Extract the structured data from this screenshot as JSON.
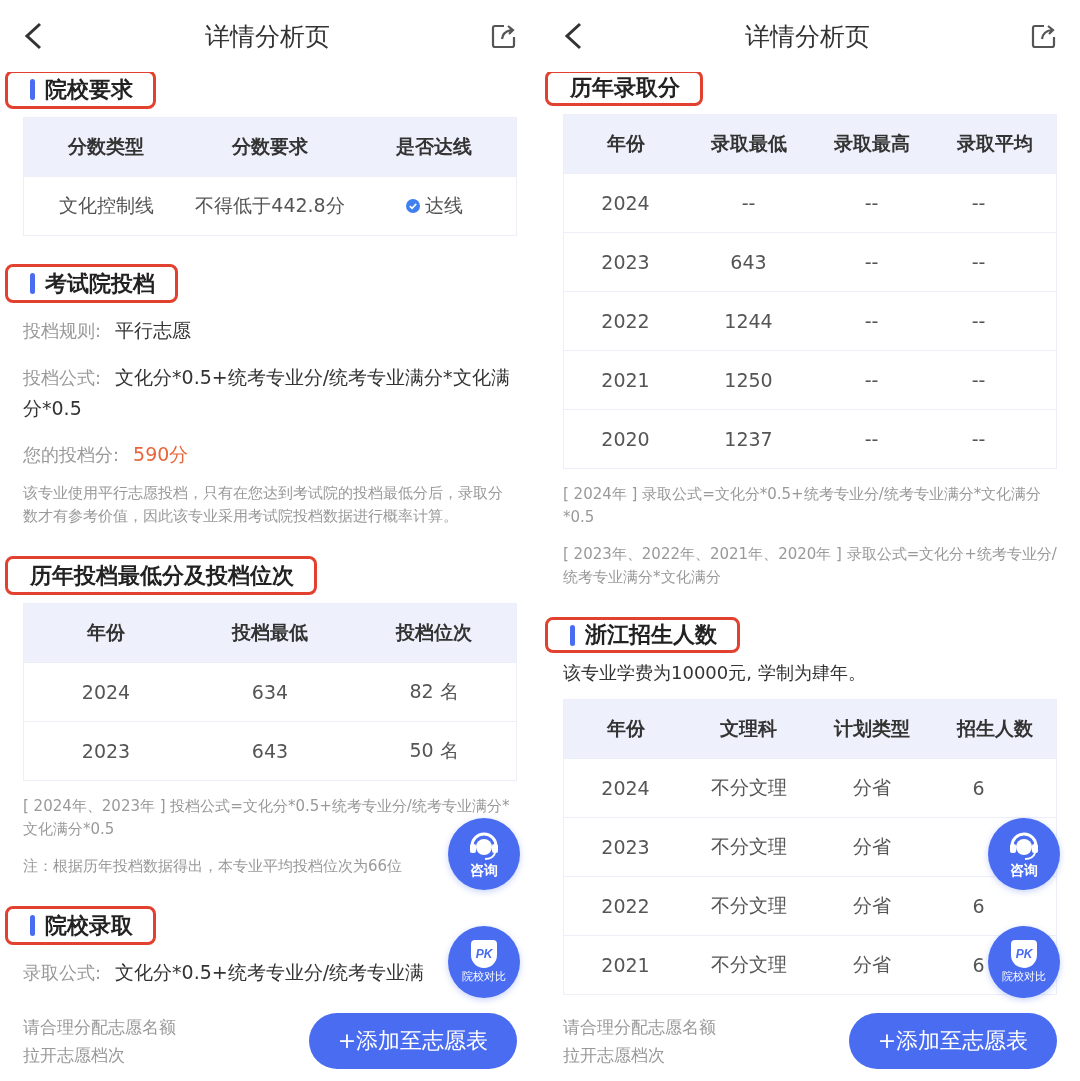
{
  "screens": [
    {
      "title": "详情分析页",
      "blocks": [
        {
          "kind": "heading",
          "text": "院校要求",
          "accent": true,
          "highlighted": true
        },
        {
          "kind": "table",
          "columns": [
            "分数类型",
            "分数要求",
            "是否达线"
          ],
          "rows": [
            {
              "cells": [
                "文化控制线",
                "不得低于442.8分",
                "达线"
              ],
              "reached": true
            }
          ]
        },
        {
          "kind": "heading",
          "text": "考试院投档",
          "accent": true,
          "highlighted": true
        },
        {
          "kind": "field",
          "label": "投档规则:",
          "value": "平行志愿",
          "emphasis": false
        },
        {
          "kind": "field",
          "label": "投档公式:",
          "value": "文化分*0.5+统考专业分/统考专业满分*文化满分*0.5",
          "emphasis": false
        },
        {
          "kind": "field",
          "label": "您的投档分:",
          "value": "590分",
          "emphasis": true
        },
        {
          "kind": "note",
          "text": "该专业使用平行志愿投档，只有在您达到考试院的投档最低分后，录取分数才有参考价值，因此该专业采用考试院投档数据进行概率计算。"
        },
        {
          "kind": "heading",
          "text": "历年投档最低分及投档位次",
          "accent": false,
          "highlighted": true
        },
        {
          "kind": "table",
          "columns": [
            "年份",
            "投档最低",
            "投档位次"
          ],
          "rows": [
            {
              "cells": [
                "2024",
                "634",
                "82 名"
              ]
            },
            {
              "cells": [
                "2023",
                "643",
                "50 名"
              ]
            }
          ]
        },
        {
          "kind": "note",
          "text": "[ 2024年、2023年 ] 投档公式=文化分*0.5+统考专业分/统考专业满分*文化满分*0.5"
        },
        {
          "kind": "note",
          "text": "注：根据历年投档数据得出，本专业平均投档位次为66位"
        },
        {
          "kind": "heading",
          "text": "院校录取",
          "accent": true,
          "highlighted": true
        },
        {
          "kind": "field",
          "label": "录取公式:",
          "value": "文化分*0.5+统考专业分/统考专业满",
          "emphasis": false
        }
      ],
      "float_buttons": [
        {
          "kind": "consult",
          "label": "咨询"
        },
        {
          "kind": "compare",
          "label": "院校对比",
          "badge": "PK"
        }
      ],
      "footer": {
        "hint_lines": [
          "请合理分配志愿名额",
          "拉开志愿档次"
        ],
        "button": "+添加至志愿表"
      }
    },
    {
      "title": "详情分析页",
      "blocks": [
        {
          "kind": "heading",
          "text": "历年录取分",
          "accent": false,
          "highlighted": true
        },
        {
          "kind": "table",
          "columns": [
            "年份",
            "录取最低",
            "录取最高",
            "录取平均"
          ],
          "rows": [
            {
              "cells": [
                "2024",
                "--",
                "--",
                "--"
              ]
            },
            {
              "cells": [
                "2023",
                "643",
                "--",
                "--"
              ]
            },
            {
              "cells": [
                "2022",
                "1244",
                "--",
                "--"
              ]
            },
            {
              "cells": [
                "2021",
                "1250",
                "--",
                "--"
              ]
            },
            {
              "cells": [
                "2020",
                "1237",
                "--",
                "--"
              ]
            }
          ]
        },
        {
          "kind": "note",
          "text": "[ 2024年 ] 录取公式=文化分*0.5+统考专业分/统考专业满分*文化满分*0.5"
        },
        {
          "kind": "note",
          "text": "[ 2023年、2022年、2021年、2020年 ] 录取公式=文化分+统考专业分/统考专业满分*文化满分"
        },
        {
          "kind": "heading",
          "text": "浙江招生人数",
          "accent": true,
          "highlighted": true
        },
        {
          "kind": "text",
          "text": "该专业学费为10000元, 学制为肆年。"
        },
        {
          "kind": "table",
          "columns": [
            "年份",
            "文理科",
            "计划类型",
            "招生人数"
          ],
          "rows": [
            {
              "cells": [
                "2024",
                "不分文理",
                "分省",
                "6"
              ]
            },
            {
              "cells": [
                "2023",
                "不分文理",
                "分省"
              ]
            },
            {
              "cells": [
                "2022",
                "不分文理",
                "分省",
                "6"
              ]
            },
            {
              "cells": [
                "2021",
                "不分文理",
                "分省",
                "6"
              ]
            }
          ]
        }
      ],
      "float_buttons": [
        {
          "kind": "consult",
          "label": "咨询"
        },
        {
          "kind": "compare",
          "label": "院校对比",
          "badge": "PK"
        }
      ],
      "footer": {
        "hint_lines": [
          "请合理分配志愿名额",
          "拉开志愿档次"
        ],
        "button": "+添加至志愿表"
      }
    }
  ]
}
